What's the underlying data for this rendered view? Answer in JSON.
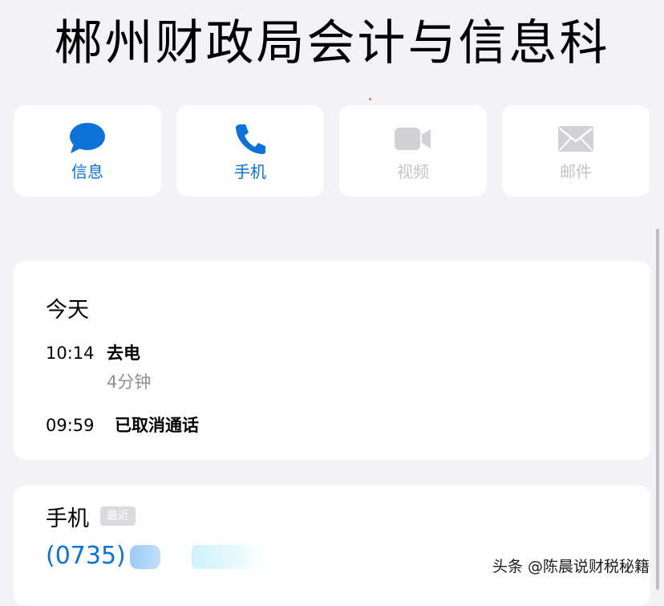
{
  "contact": {
    "name": "郴州财政局会计与信息科"
  },
  "actions": [
    {
      "label": "信息",
      "icon": "message-bubble-icon",
      "enabled": true
    },
    {
      "label": "手机",
      "icon": "phone-icon",
      "enabled": true
    },
    {
      "label": "视频",
      "icon": "video-camera-icon",
      "enabled": false
    },
    {
      "label": "邮件",
      "icon": "mail-envelope-icon",
      "enabled": false
    }
  ],
  "recents": {
    "day": "今天",
    "calls": [
      {
        "time": "10:14",
        "type": "去电",
        "duration": "4分钟"
      },
      {
        "time": "09:59",
        "type": "已取消通话"
      }
    ]
  },
  "phone": {
    "label": "手机",
    "badge": "最近",
    "number_visible": "(0735)"
  },
  "watermark": "头条 @陈晨说财税秘籍",
  "colors": {
    "accent": "#0a72d9",
    "disabled": "#c4c4c8",
    "background": "#f2f2f7",
    "card": "#ffffff"
  }
}
